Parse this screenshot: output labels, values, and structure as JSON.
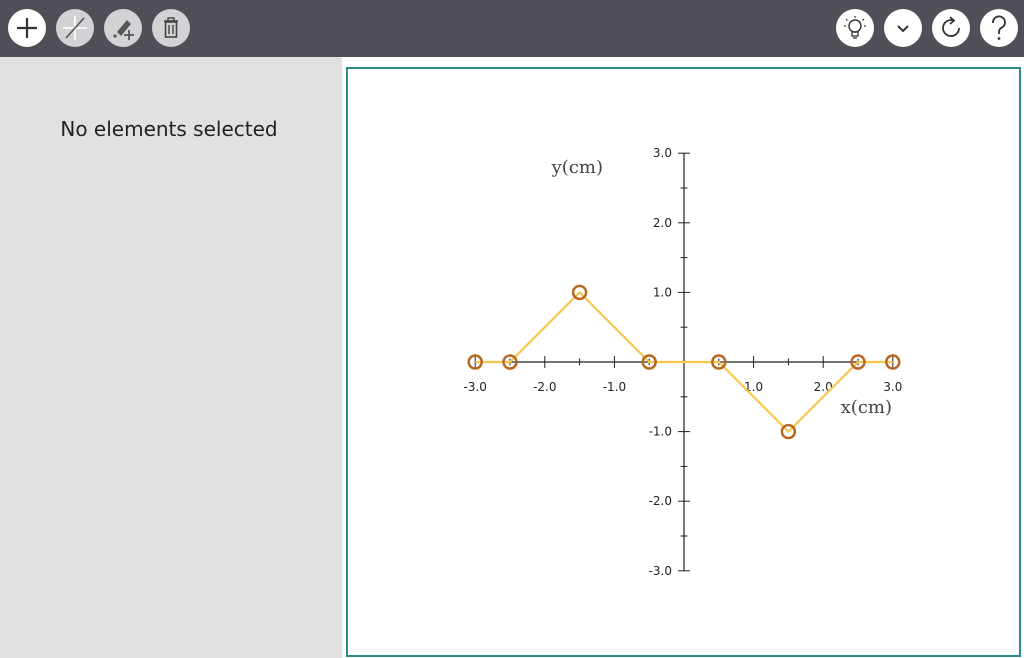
{
  "toolbar": {
    "left_buttons": [
      {
        "name": "add",
        "icon": "plus-icon",
        "enabled": true
      },
      {
        "name": "line",
        "icon": "line-tool-icon",
        "enabled": false
      },
      {
        "name": "edit",
        "icon": "pen-plus-icon",
        "enabled": false
      },
      {
        "name": "delete",
        "icon": "trash-icon",
        "enabled": false
      }
    ],
    "right_buttons": [
      {
        "name": "hint",
        "icon": "lightbulb-icon"
      },
      {
        "name": "collapse",
        "icon": "chevron-down-icon"
      },
      {
        "name": "redo",
        "icon": "redo-icon"
      },
      {
        "name": "help",
        "icon": "question-icon"
      }
    ]
  },
  "sidebar": {
    "message": "No elements selected"
  },
  "colors": {
    "toolbar_bg": "#4f4f57",
    "canvas_border": "#2a8c86",
    "line": "#f9c74f",
    "point_stroke": "#b5651d"
  },
  "chart_data": {
    "type": "line",
    "xlabel": "x(cm)",
    "ylabel": "y(cm)",
    "xlim": [
      -3.0,
      3.0
    ],
    "ylim": [
      -3.0,
      3.0
    ],
    "x_ticks": [
      "-3.0",
      "-2.0",
      "-1.0",
      "1.0",
      "2.0",
      "3.0"
    ],
    "y_ticks": [
      "3.0",
      "2.0",
      "1.0",
      "-1.0",
      "-2.0",
      "-3.0"
    ],
    "x_tick_values": [
      -3.0,
      -2.0,
      -1.0,
      1.0,
      2.0,
      3.0
    ],
    "y_tick_values": [
      3.0,
      2.0,
      1.0,
      -1.0,
      -2.0,
      -3.0
    ],
    "minor_step": 0.5,
    "line_points": {
      "x": [
        -3.0,
        -2.5,
        -1.5,
        -0.5,
        0.5,
        1.5,
        2.5,
        3.0
      ],
      "y": [
        0,
        0,
        1.0,
        0,
        0,
        -1.0,
        0,
        0
      ]
    },
    "markers": {
      "x": [
        -3.0,
        -2.5,
        -1.5,
        -0.5,
        0.5,
        1.5,
        2.5,
        3.0
      ],
      "y": [
        0,
        0,
        1.0,
        0,
        0,
        -1.0,
        0,
        0
      ]
    },
    "grid": false
  }
}
